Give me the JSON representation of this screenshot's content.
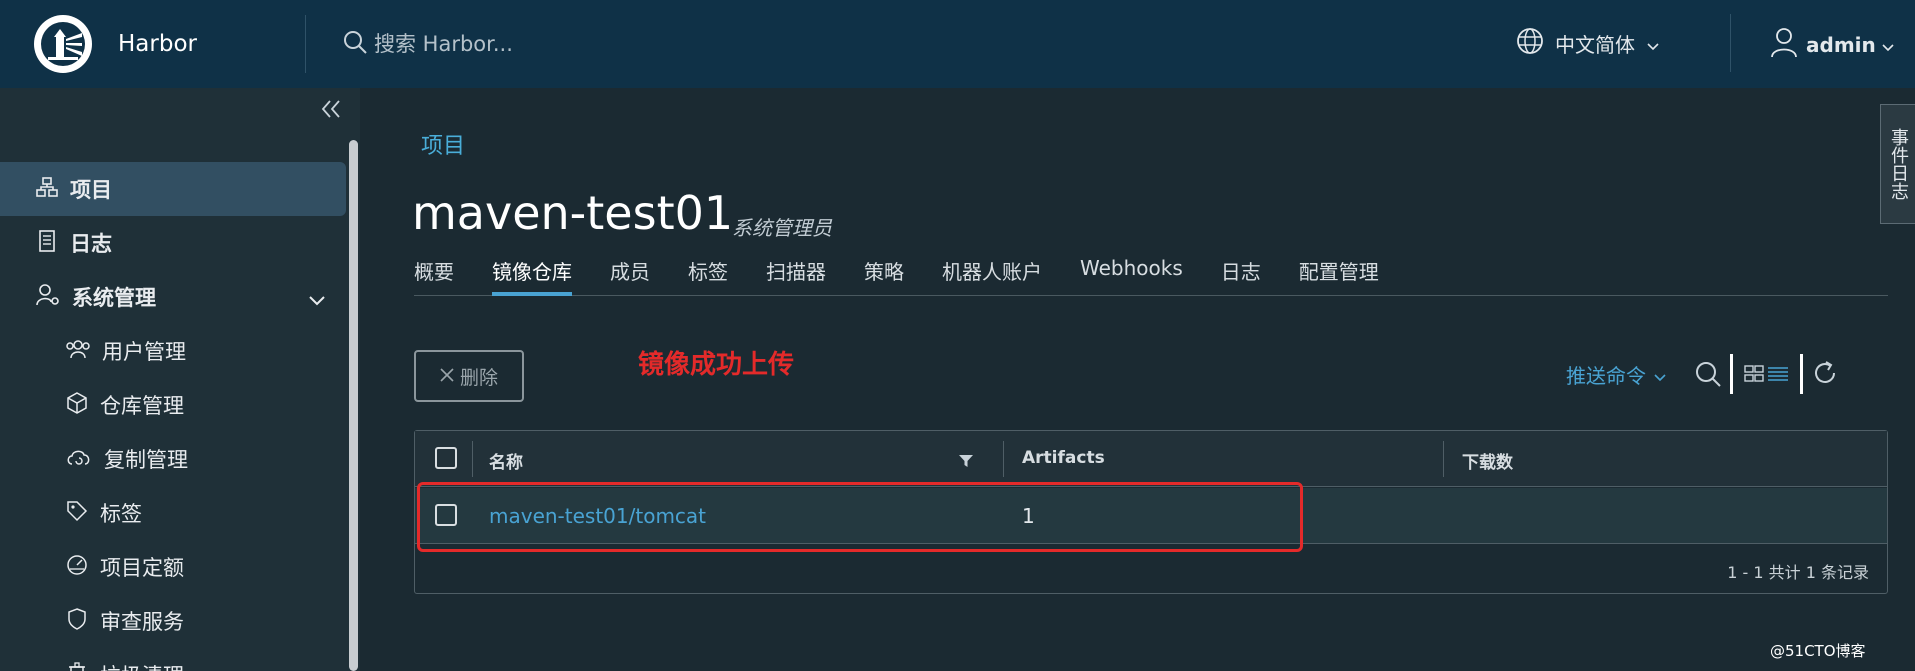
{
  "header": {
    "brand": "Harbor",
    "search_placeholder": "搜索 Harbor...",
    "language": "中文简体",
    "user": "admin"
  },
  "sidebar": {
    "items": [
      {
        "label": "项目"
      },
      {
        "label": "日志"
      },
      {
        "label": "系统管理"
      },
      {
        "label": "用户管理"
      },
      {
        "label": "仓库管理"
      },
      {
        "label": "复制管理"
      },
      {
        "label": "标签"
      },
      {
        "label": "项目定额"
      },
      {
        "label": "审查服务"
      },
      {
        "label": "垃圾清理"
      }
    ]
  },
  "event_log": "事件日志",
  "breadcrumb": "项目",
  "project": {
    "title": "maven-test01",
    "role": "系统管理员"
  },
  "tabs": [
    {
      "label": "概要"
    },
    {
      "label": "镜像仓库"
    },
    {
      "label": "成员"
    },
    {
      "label": "标签"
    },
    {
      "label": "扫描器"
    },
    {
      "label": "策略"
    },
    {
      "label": "机器人账户"
    },
    {
      "label": "Webhooks"
    },
    {
      "label": "日志"
    },
    {
      "label": "配置管理"
    }
  ],
  "toolbar": {
    "delete_label": "删除",
    "push_command": "推送命令"
  },
  "annotation": "镜像成功上传",
  "table": {
    "columns": [
      "名称",
      "Artifacts",
      "下载数"
    ],
    "rows": [
      {
        "name": "maven-test01/tomcat",
        "artifacts": "1",
        "downloads": ""
      }
    ],
    "pagination": "1 - 1 共计 1 条记录"
  },
  "watermark": "@51CTO博客"
}
